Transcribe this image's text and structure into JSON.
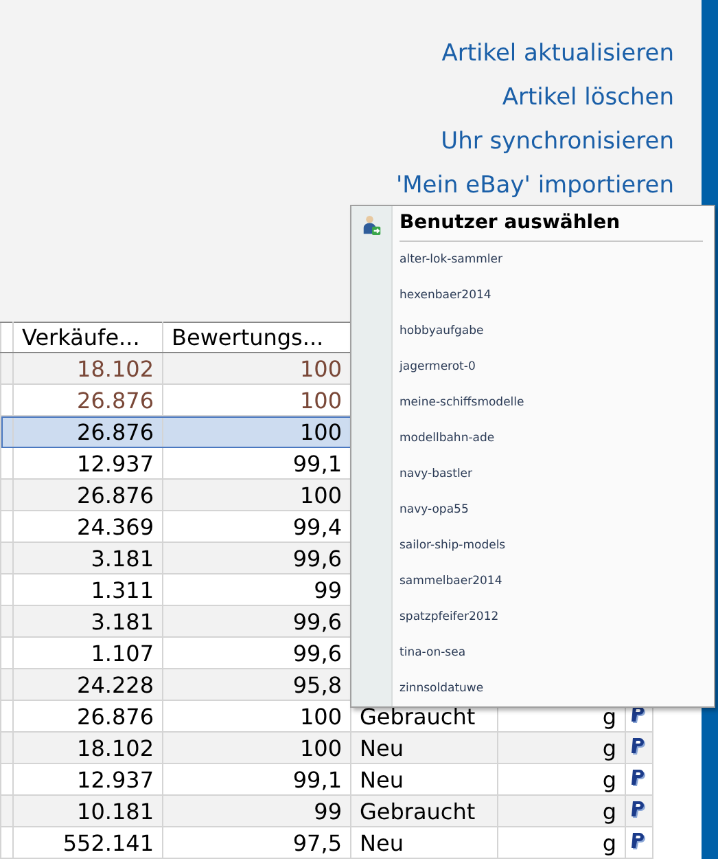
{
  "actions": [
    "Artikel aktualisieren",
    "Artikel löschen",
    "Uhr synchronisieren",
    "'Mein eBay' importieren"
  ],
  "table": {
    "columns": [
      "Verkäufe...",
      "Bewertungs..."
    ],
    "rows": [
      {
        "sales": "18.102",
        "rating": "100",
        "selected": false,
        "color": "#7a4838"
      },
      {
        "sales": "26.876",
        "rating": "100",
        "selected": false,
        "color": "#7a4838"
      },
      {
        "sales": "26.876",
        "rating": "100",
        "selected": true,
        "color": "#000000"
      },
      {
        "sales": "12.937",
        "rating": "99,1",
        "selected": false,
        "color": "#000000"
      },
      {
        "sales": "26.876",
        "rating": "100",
        "selected": false,
        "color": "#000000"
      },
      {
        "sales": "24.369",
        "rating": "99,4",
        "selected": false,
        "color": "#000000"
      },
      {
        "sales": "3.181",
        "rating": "99,6",
        "selected": false,
        "color": "#000000"
      },
      {
        "sales": "1.311",
        "rating": "99",
        "selected": false,
        "color": "#000000"
      },
      {
        "sales": "3.181",
        "rating": "99,6",
        "selected": false,
        "color": "#000000"
      },
      {
        "sales": "1.107",
        "rating": "99,6",
        "selected": false,
        "color": "#000000"
      },
      {
        "sales": "24.228",
        "rating": "95,8",
        "selected": false,
        "color": "#000000"
      },
      {
        "sales": "26.876",
        "rating": "100",
        "column_4": "Gebraucht",
        "column_5": "g",
        "payment_icon": true,
        "selected": false,
        "color": "#000000"
      },
      {
        "sales": "18.102",
        "rating": "100",
        "column_4": "Neu",
        "column_5": "g",
        "payment_icon": true,
        "selected": false,
        "color": "#000000"
      },
      {
        "sales": "12.937",
        "rating": "99,1",
        "column_4": "Neu",
        "column_5": "g",
        "payment_icon": true,
        "selected": false,
        "color": "#000000"
      },
      {
        "sales": "10.181",
        "rating": "99",
        "column_4": "Gebraucht",
        "column_5": "g",
        "payment_icon": true,
        "selected": false,
        "color": "#000000"
      },
      {
        "sales": "552.141",
        "rating": "97,5",
        "column_4": "Neu",
        "column_5": "g",
        "payment_icon": true,
        "selected": false,
        "color": "#000000"
      }
    ]
  },
  "menu": {
    "title": "Benutzer auswählen",
    "items": [
      "alter-lok-sammler",
      "hexenbaer2014",
      "hobbyaufgabe",
      "jagermerot-0",
      "meine-schiffsmodelle",
      "modellbahn-ade",
      "navy-bastler",
      "navy-opa55",
      "sailor-ship-models",
      "sammelbaer2014",
      "spatzpfeifer2012",
      "tina-on-sea",
      "zinnsoldatuwe"
    ]
  }
}
